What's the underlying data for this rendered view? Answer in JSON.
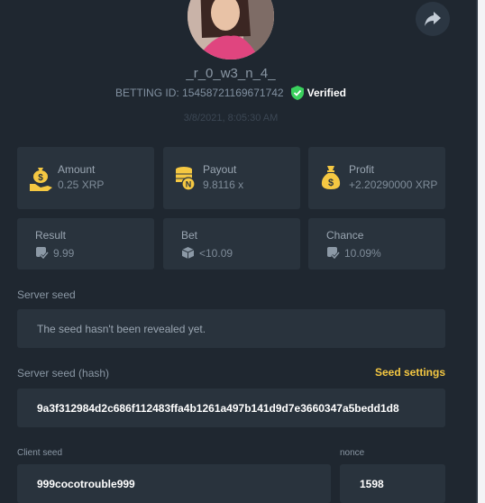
{
  "profile": {
    "username": "_r_0_w3_n_4_",
    "betting_id": "BETTING ID: 15458721169671742",
    "verified_label": "Verified",
    "datetime": "3/8/2021, 8:05:30 AM"
  },
  "stats": {
    "amount": {
      "label": "Amount",
      "value": "0.25 XRP",
      "icon": "money-bag-hand-icon"
    },
    "payout": {
      "label": "Payout",
      "value": "9.8116 x",
      "icon": "coin-stack-icon"
    },
    "profit": {
      "label": "Profit",
      "value": "+2.20290000 XRP",
      "icon": "money-bag-icon"
    },
    "result": {
      "label": "Result",
      "value": "9.99"
    },
    "bet": {
      "label": "Bet",
      "value": "<10.09"
    },
    "chance": {
      "label": "Chance",
      "value": "10.09%"
    }
  },
  "server_seed": {
    "label": "Server seed",
    "value": "The seed hasn't been revealed yet."
  },
  "server_seed_hash": {
    "label": "Server seed (hash)",
    "settings_link": "Seed settings",
    "value": "9a3f312984d2c686f112483ffa4b1261a497b141d9d7e3660347a5bedd1d8"
  },
  "client_seed": {
    "label": "Client seed",
    "value": "999cocotrouble999"
  },
  "nonce": {
    "label": "nonce",
    "value": "1598"
  },
  "colors": {
    "accent": "#f5c842",
    "verified": "#3ad15d",
    "card": "#29333d",
    "background": "#1f2730"
  }
}
